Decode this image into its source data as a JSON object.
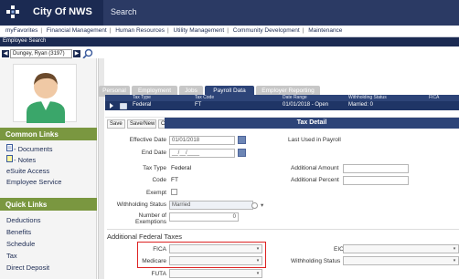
{
  "header": {
    "brand": "City Of NWS",
    "search_label": "Search"
  },
  "menu": [
    "myFavorites",
    "Financial Management",
    "Human Resources",
    "Utility Management",
    "Community Development",
    "Maintenance"
  ],
  "employee_search": {
    "label": "Employee Search",
    "value": "Dungey, Ryan (3197)"
  },
  "sidebar": {
    "common_links": {
      "title": "Common Links",
      "items": [
        "- Documents",
        "- Notes",
        "eSuite Access",
        "Employee Service"
      ]
    },
    "quick_links": {
      "title": "Quick Links",
      "items": [
        "Deductions",
        "Benefits",
        "Schedule",
        "Tax",
        "Direct Deposit"
      ]
    }
  },
  "tabs": [
    "Personal",
    "Employment",
    "Jobs",
    "Payroll Data",
    "Employer Reporting"
  ],
  "grid": {
    "headers": [
      "Tax Type",
      "Tax Code",
      "Date Range",
      "Withholding Status",
      "FICA"
    ],
    "row": {
      "tax_type": "Federal",
      "tax_code": "FT",
      "date_range": "01/01/2018 - Open",
      "withholding": "Married: 0"
    }
  },
  "toolbar": {
    "save": "Save",
    "save_new": "Save/New",
    "cancel": "Cancel"
  },
  "detail_title": "Tax Detail",
  "form": {
    "effective_date_label": "Effective Date",
    "effective_date_value": "01/01/2018",
    "end_date_label": "End Date",
    "end_date_value": "__/__/____",
    "last_used_label": "Last Used in Payroll",
    "tax_type_label": "Tax Type",
    "tax_type_value": "Federal",
    "code_label": "Code",
    "code_value": "FT",
    "exempt_label": "Exempt",
    "withholding_label": "Withholding Status",
    "withholding_value": "Married",
    "exemptions_label_1": "Number of",
    "exemptions_label_2": "Exemptions",
    "exemptions_value": "0",
    "additional_amount_label": "Additional Amount",
    "additional_percent_label": "Additional Percent",
    "additional_federal_title": "Additional Federal Taxes",
    "fica_label": "FICA",
    "medicare_label": "Medicare",
    "futa_label": "FUTA",
    "eic_label": "EIC",
    "eic_withholding_label": "Withholding Status"
  }
}
